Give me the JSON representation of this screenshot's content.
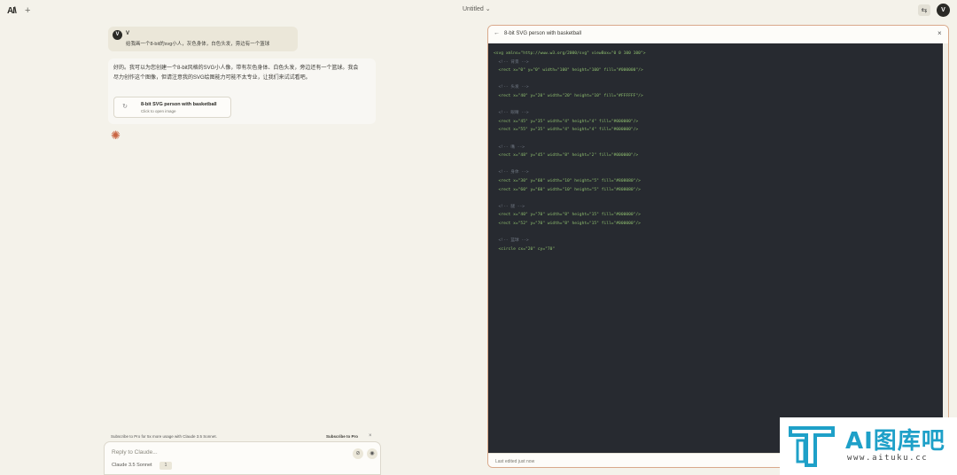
{
  "topbar": {
    "logo": "AI\\",
    "new_chat_icon": "+",
    "title": "Untitled",
    "title_chevron": "⌄",
    "settings_icon": "⇆",
    "user_initial": "V"
  },
  "conversation": {
    "user_message": {
      "initial": "V",
      "name": "V",
      "text": "给我画一个8-bit的svg小人，灰色身体，白色头发，旁边有一个篮球"
    },
    "assistant_message": {
      "text": "好的。我可以为您创建一个8-bit风格的SVG小人像，带有灰色身体、白色头发，旁边还有一个篮球。我会尽力创作这个图像，但请注意我的SVG绘图能力可能不太专业，让我们来试试看吧。",
      "artifact_title": "8-bit SVG person with basketball",
      "artifact_subtitle": "Click to open image",
      "artifact_icon": "↻",
      "thinking_icon": "✺"
    }
  },
  "composer": {
    "subscribe_text": "Subscribe to Pro for 5x more usage with Claude 3.5 Sonnet.",
    "subscribe_link": "Subscribe to Pro",
    "subscribe_close": "×",
    "placeholder": "Reply to Claude...",
    "model": "Claude 3.5 Sonnet",
    "model_badge": "1",
    "attach_icon": "⊘",
    "photo_icon": "◉"
  },
  "artifact_panel": {
    "back_icon": "←",
    "title": "8-bit SVG person with basketball",
    "close_icon": "×",
    "footer": "Last edited just now",
    "code_lines": [
      {
        "t": "tag",
        "s": "<svg xmlns=\"http://www.w3.org/2000/svg\" viewBox=\"0 0 100 100\">"
      },
      {
        "t": "com",
        "s": "  <!-- 背景 -->"
      },
      {
        "t": "tag",
        "s": "  <rect x=\"0\" y=\"0\" width=\"100\" height=\"100\" fill=\"#000000\"/>"
      },
      {
        "t": "blank",
        "s": ""
      },
      {
        "t": "com",
        "s": "  <!-- 头发 -->"
      },
      {
        "t": "tag",
        "s": "  <rect x=\"40\" y=\"20\" width=\"20\" height=\"10\" fill=\"#FFFFFF\"/>"
      },
      {
        "t": "blank",
        "s": ""
      },
      {
        "t": "com",
        "s": "  <!-- 眼睛 -->"
      },
      {
        "t": "tag",
        "s": "  <rect x=\"45\" y=\"35\" width=\"4\" height=\"4\" fill=\"#000000\"/>"
      },
      {
        "t": "tag",
        "s": "  <rect x=\"55\" y=\"35\" width=\"4\" height=\"4\" fill=\"#000000\"/>"
      },
      {
        "t": "blank",
        "s": ""
      },
      {
        "t": "com",
        "s": "  <!-- 嘴 -->"
      },
      {
        "t": "tag",
        "s": "  <rect x=\"48\" y=\"45\" width=\"8\" height=\"2\" fill=\"#000000\"/>"
      },
      {
        "t": "blank",
        "s": ""
      },
      {
        "t": "com",
        "s": "  <!-- 身体 -->"
      },
      {
        "t": "tag",
        "s": "  <rect x=\"30\" y=\"60\" width=\"10\" height=\"5\" fill=\"#808080\"/>"
      },
      {
        "t": "tag",
        "s": "  <rect x=\"60\" y=\"60\" width=\"10\" height=\"5\" fill=\"#808080\"/>"
      },
      {
        "t": "blank",
        "s": ""
      },
      {
        "t": "com",
        "s": "  <!-- 腿 -->"
      },
      {
        "t": "tag",
        "s": "  <rect x=\"40\" y=\"70\" width=\"8\" height=\"15\" fill=\"#000000\"/>"
      },
      {
        "t": "tag",
        "s": "  <rect x=\"52\" y=\"70\" width=\"8\" height=\"15\" fill=\"#000000\"/>"
      },
      {
        "t": "blank",
        "s": ""
      },
      {
        "t": "com",
        "s": "  <!-- 篮球 -->"
      },
      {
        "t": "tag",
        "s": "  <circle cx=\"20\" cy=\"70\""
      }
    ]
  },
  "watermark": {
    "title": "AI图库吧",
    "url": "www.aituku.cc"
  },
  "colors": {
    "background": "#f4f2ea",
    "accent": "#c96442",
    "code_bg": "#272a30",
    "watermark": "#1ea0c8"
  }
}
